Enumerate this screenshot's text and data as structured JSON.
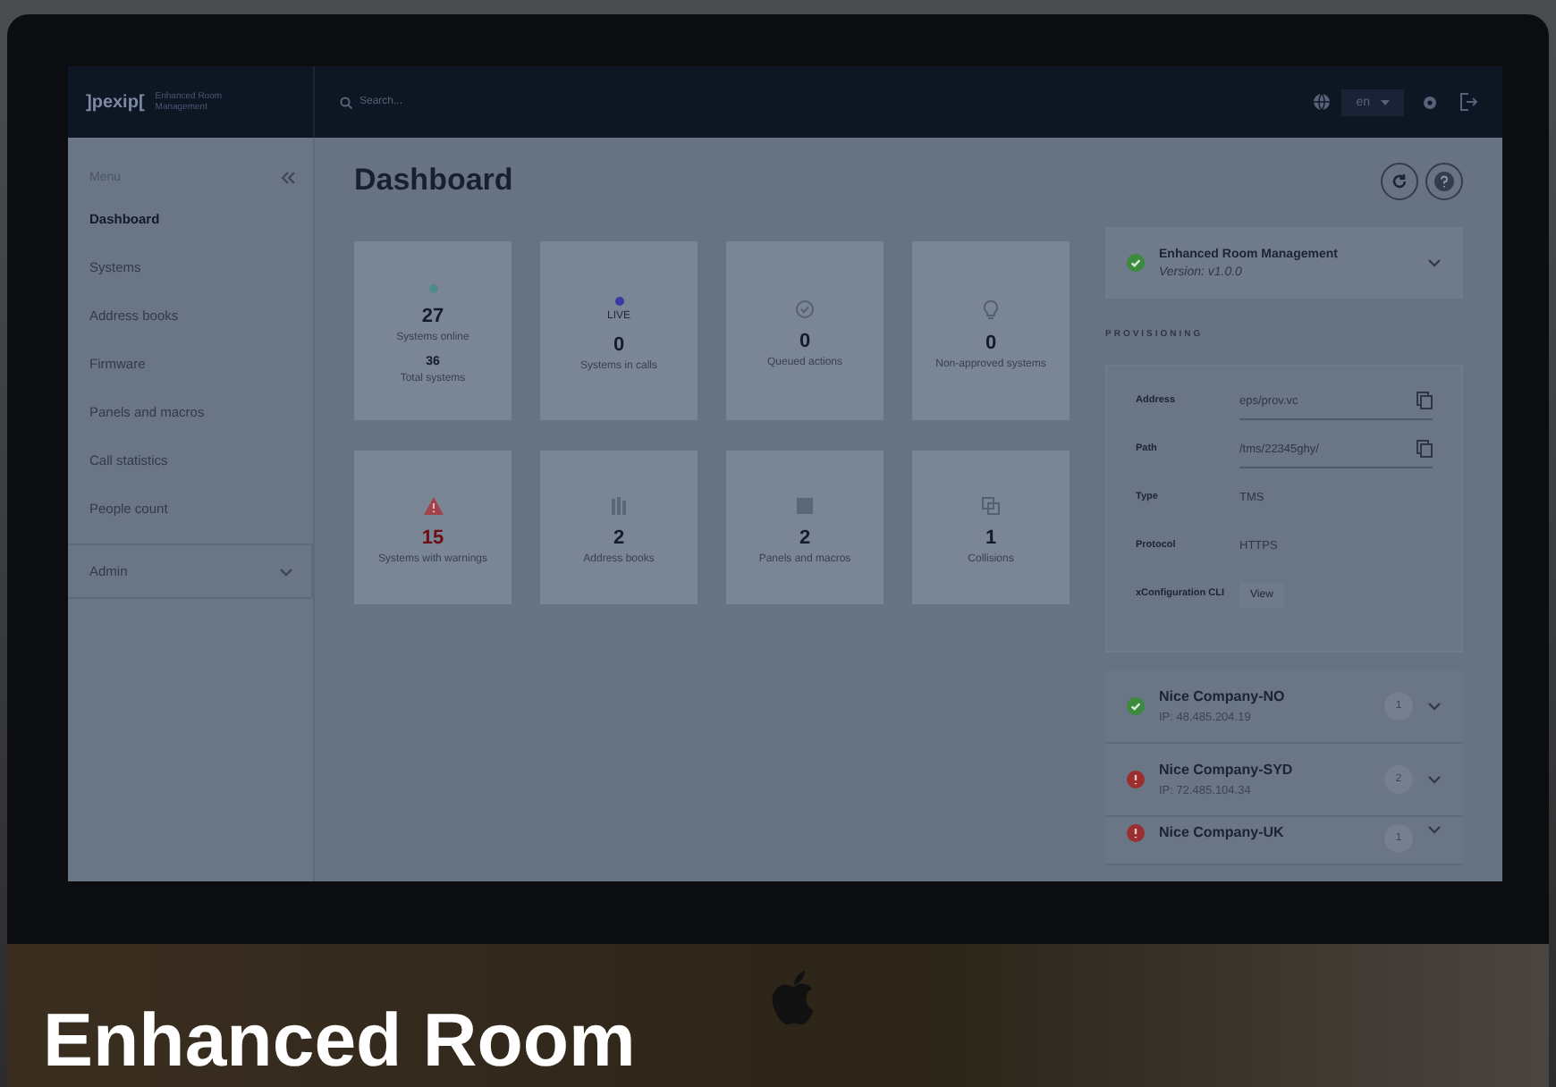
{
  "topbar": {
    "logo": "]pexip[",
    "product": "Enhanced Room Management",
    "search": {
      "placeholder": "Search..."
    },
    "language": "en"
  },
  "sidebar": {
    "title": "Menu",
    "items": [
      {
        "label": "Dashboard",
        "selected": true
      },
      {
        "label": "Systems",
        "selected": false
      },
      {
        "label": "Address books",
        "selected": false
      },
      {
        "label": "Firmware",
        "selected": false
      },
      {
        "label": "Panels and macros",
        "selected": false
      },
      {
        "label": "Call statistics",
        "selected": false
      },
      {
        "label": "People count",
        "selected": false
      }
    ],
    "admin": {
      "label": "Admin",
      "expanded": false
    }
  },
  "page_title": "Dashboard",
  "stats": [
    {
      "kind": "online",
      "value": "27",
      "label": "Systems online",
      "sub_value": "36",
      "sub_label": "Total systems"
    },
    {
      "kind": "live",
      "badge": "LIVE",
      "value": "0",
      "label": "Systems in calls"
    },
    {
      "kind": "queued",
      "value": "0",
      "label": "Queued actions"
    },
    {
      "kind": "pending",
      "value": "0",
      "label": "Non-approved systems"
    },
    {
      "kind": "warning",
      "value": "15",
      "label": "Systems with warnings"
    },
    {
      "kind": "books",
      "value": "2",
      "label": "Address books"
    },
    {
      "kind": "panels",
      "value": "2",
      "label": "Panels and macros"
    },
    {
      "kind": "collisions",
      "value": "1",
      "label": "Collisions"
    }
  ],
  "system": {
    "name": "Enhanced Room Management",
    "version": "Version: v1.0.0",
    "healthy": true
  },
  "provisioning": {
    "heading": "PROVISIONING",
    "fields": [
      {
        "kind": "copy",
        "label": "Address",
        "value": "eps/prov.vc"
      },
      {
        "kind": "copy",
        "label": "Path",
        "value": "/tms/22345ghy/"
      },
      {
        "kind": "text",
        "label": "Type",
        "value": "TMS"
      },
      {
        "kind": "text",
        "label": "Protocol",
        "value": "HTTPS"
      },
      {
        "kind": "button",
        "label": "xConfiguration CLI",
        "value": "View"
      }
    ]
  },
  "sites": [
    {
      "name": "Nice Company-NO",
      "ip": "IP: 48.485.204.19",
      "healthy": true,
      "count": "1"
    },
    {
      "name": "Nice Company-SYD",
      "ip": "IP: 72.485.104.34",
      "healthy": false,
      "count": "2"
    },
    {
      "name": "Nice Company-UK",
      "healthy": false,
      "count": "1"
    }
  ],
  "headline": "Enhanced Room"
}
